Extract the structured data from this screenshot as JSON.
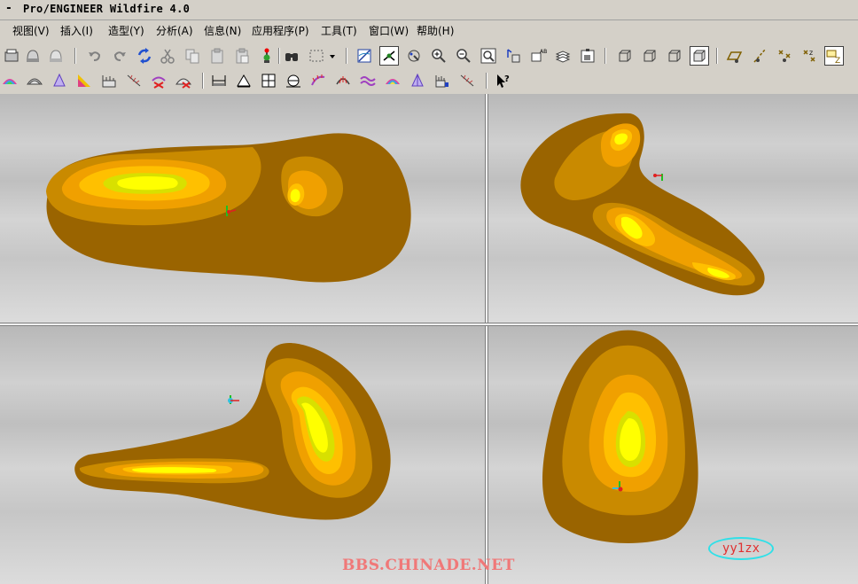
{
  "window": {
    "system_glyph": "-",
    "title": "Pro/ENGINEER Wildfire 4.0"
  },
  "menu": [
    {
      "id": "view",
      "label": "视图(V)"
    },
    {
      "id": "insert",
      "label": "插入(I)"
    },
    {
      "id": "shape",
      "label": "造型(Y)"
    },
    {
      "id": "analysis",
      "label": "分析(A)"
    },
    {
      "id": "info",
      "label": "信息(N)"
    },
    {
      "id": "apps",
      "label": "应用程序(P)"
    },
    {
      "id": "tools",
      "label": "工具(T)"
    },
    {
      "id": "window",
      "label": "窗口(W)"
    },
    {
      "id": "help",
      "label": "帮助(H)"
    }
  ],
  "toolbar_icons": {
    "row1": [
      "new-icon",
      "open-icon",
      "save-icon",
      "undo-icon",
      "redo-icon",
      "regenerate-icon",
      "cut-icon",
      "copy-icon",
      "paste-icon",
      "paste-special-icon",
      "model-tree-icon",
      "find-icon",
      "select-box-icon",
      "repaint-icon",
      "spin-center-icon",
      "orient-icon",
      "zoom-in-icon",
      "zoom-out-icon",
      "refit-icon",
      "reorient-icon",
      "saved-views-icon",
      "layers-icon",
      "view-manager-icon",
      "wireframe-icon",
      "hidden-line-icon",
      "no-hidden-icon",
      "shading-icon",
      "datum-planes-icon",
      "datum-axes-icon",
      "datum-points-icon",
      "coordinate-systems-icon",
      "annotation-icon"
    ],
    "row2": [
      "curvature-icon",
      "section-icon",
      "offset-icon",
      "draft-icon",
      "quilt-curve-icon",
      "shaded-curvature-icon",
      "reflection-icon",
      "deviation-icon",
      "measure-length-icon",
      "measure-area-icon",
      "measure-distance-icon",
      "measure-angle-icon",
      "curve-analysis-icon",
      "dihedral-icon",
      "slope-icon",
      "shade-analysis-icon",
      "graph-icon",
      "sensitivity-icon",
      "whats-this-icon"
    ]
  },
  "watermark": "BBS.CHINADE.NET",
  "author_tag": "yy1zx",
  "colors": {
    "surface_dark": "#9a6400",
    "surface_mid": "#c98a00",
    "surface_orange": "#f0a000",
    "surface_light": "#ffc000",
    "surface_yellowgreen": "#d8e000",
    "surface_yellow": "#ffff00"
  }
}
